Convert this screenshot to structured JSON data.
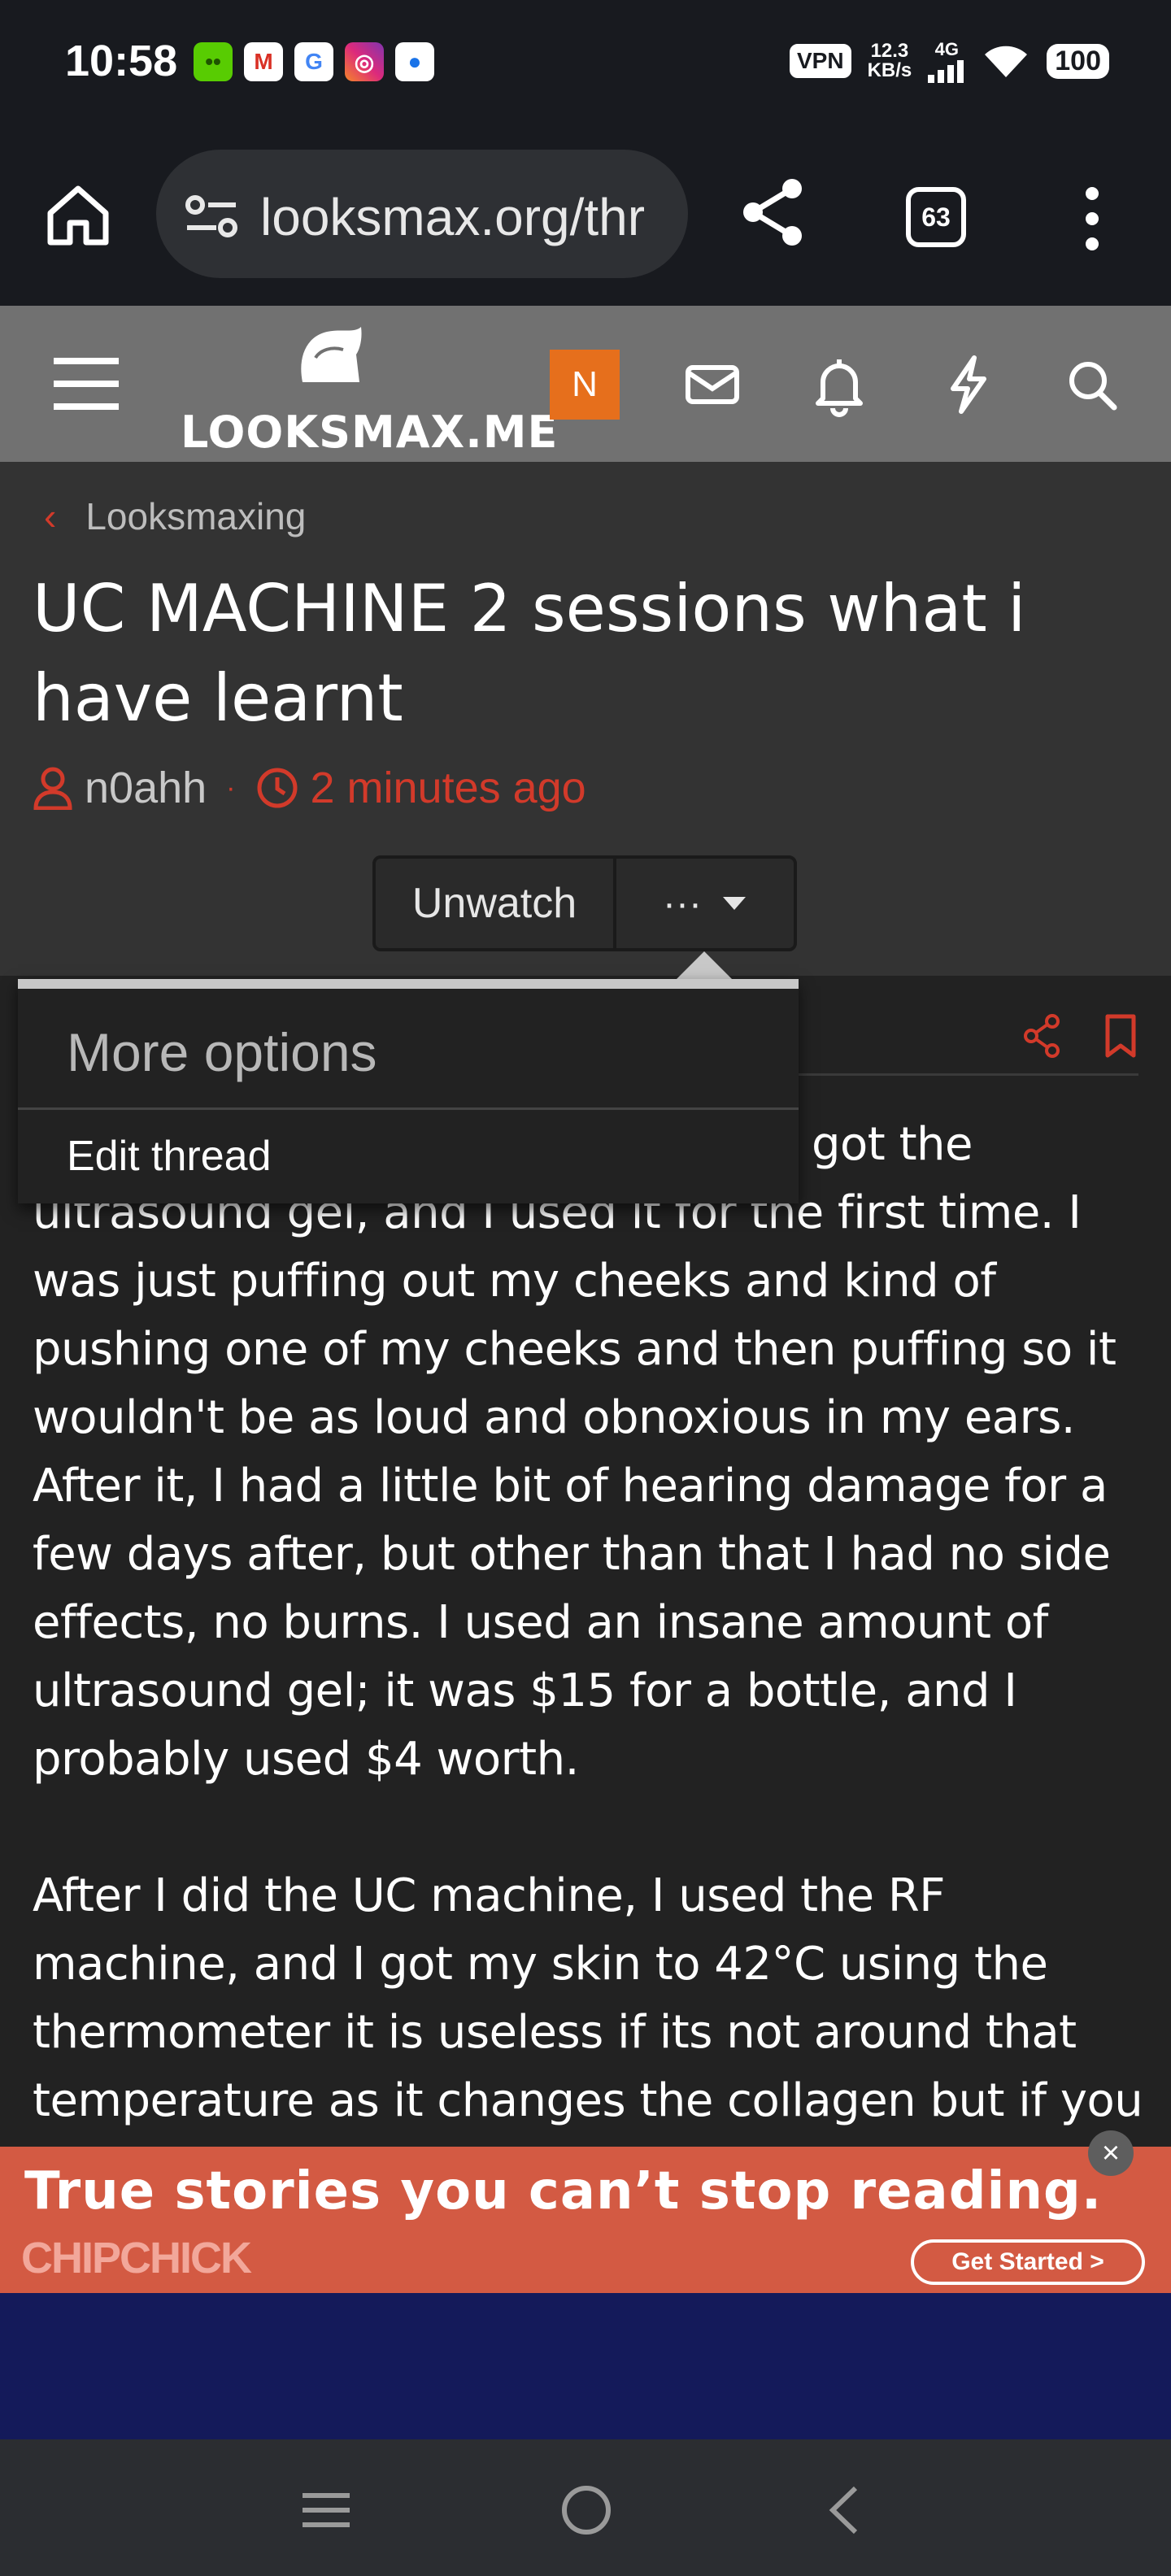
{
  "status_bar": {
    "time": "10:58",
    "vpn": "VPN",
    "speed_value": "12.3",
    "speed_unit": "KB/s",
    "network": "4G",
    "battery": "100"
  },
  "browser": {
    "url": "looksmax.org/thr",
    "tab_count": "63"
  },
  "site": {
    "logo_text": "LOOKSMAX.ME",
    "avatar_letter": "N",
    "accent_color": "#d23a2a",
    "avatar_color": "#e66f1c"
  },
  "thread": {
    "breadcrumb": "Looksmaxing",
    "title": "UC MACHINE 2 sessions what i have learnt",
    "author": "n0ahh",
    "time": "2 minutes ago",
    "unwatch_label": "Unwatch",
    "more_label": "···"
  },
  "menu": {
    "title": "More options",
    "items": [
      "Edit thread"
    ]
  },
  "post": {
    "paragraph_1": "got the ultrasound gel, and I used it for the first time. I was just puffing out my cheeks and kind of pushing one of my cheeks and then puffing so it wouldn't be as loud and obnoxious in my ears. After it, I had a little bit of hearing damage for a few days after, but other than that I had no side effects, no burns. I used an insane amount of ultrasound gel; it was $15 for a bottle, and I probably used $4 worth.",
    "paragraph_2": "After I did the UC machine, I used the RF machine, and I got my skin to 42°C using the thermometer it is useless if its not around that temperature as it changes the collagen but if you"
  },
  "ad": {
    "headline": "True stories you can’t stop reading.",
    "brand": "CHIPCHICK",
    "cta": "Get Started >",
    "close": "×"
  }
}
